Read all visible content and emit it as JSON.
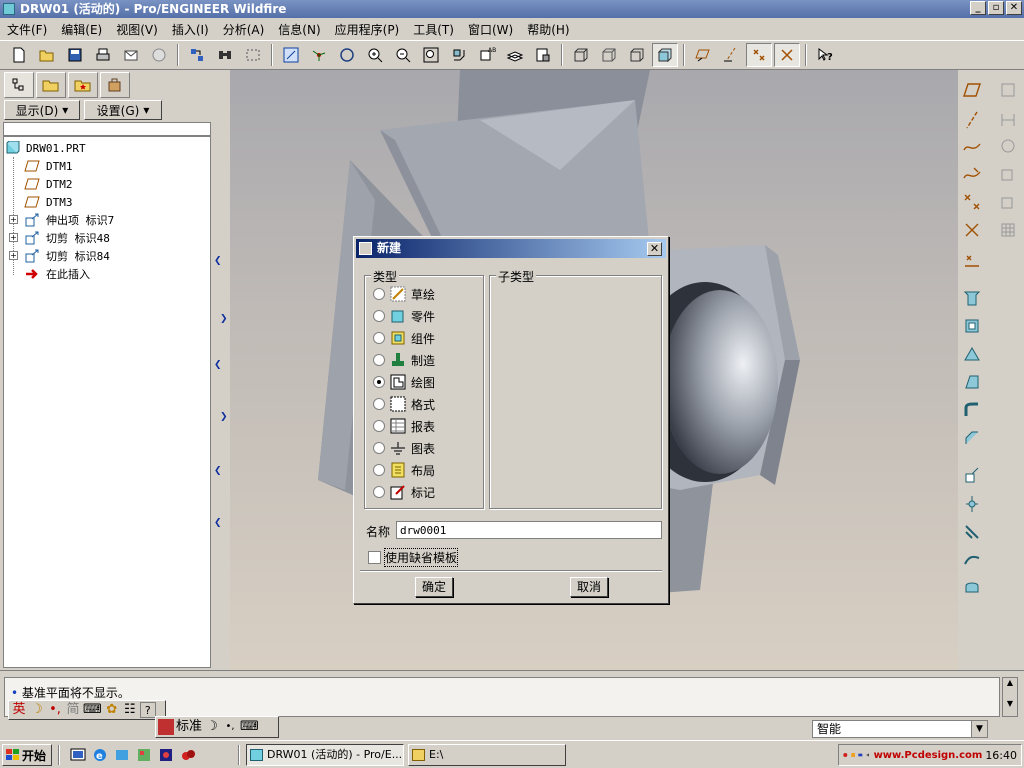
{
  "window": {
    "title": "DRW01 (活动的) - Pro/ENGINEER Wildfire",
    "min": "_",
    "restore": "▫",
    "close": "✕"
  },
  "menu": [
    "文件(F)",
    "编辑(E)",
    "视图(V)",
    "插入(I)",
    "分析(A)",
    "信息(N)",
    "应用程序(P)",
    "工具(T)",
    "窗口(W)",
    "帮助(H)"
  ],
  "toolbar_icons": [
    "new-icon",
    "open-icon",
    "save-icon",
    "print-icon",
    "email-icon",
    "send-icon",
    "regenerate-icon",
    "find-icon",
    "select-box-icon",
    "repaint-icon",
    "spin-center-icon",
    "orient-icon",
    "zoom-in-icon",
    "zoom-out-icon",
    "refit-icon",
    "reorient-icon",
    "saved-view-icon",
    "layers-icon",
    "view-manager-icon",
    "wireframe-icon",
    "hidden-line-icon",
    "no-hidden-icon",
    "shading-icon",
    "datum-plane-display-icon",
    "datum-axis-display-icon",
    "datum-point-display-icon",
    "csys-display-icon",
    "context-help-icon"
  ],
  "left_panel": {
    "show_button": "显示(D)",
    "settings_button": "设置(G)",
    "tree": [
      {
        "label": "DRW01.PRT",
        "icon": "part-icon",
        "indent": 0,
        "expand": ""
      },
      {
        "label": "DTM1",
        "icon": "datum-plane-icon",
        "indent": 1,
        "expand": ""
      },
      {
        "label": "DTM2",
        "icon": "datum-plane-icon",
        "indent": 1,
        "expand": ""
      },
      {
        "label": "DTM3",
        "icon": "datum-plane-icon",
        "indent": 1,
        "expand": ""
      },
      {
        "label": "伸出项 标识7",
        "icon": "extrude-icon",
        "indent": 1,
        "expand": "+"
      },
      {
        "label": "切剪 标识48",
        "icon": "cut-icon",
        "indent": 1,
        "expand": "+"
      },
      {
        "label": "切剪 标识84",
        "icon": "cut-icon",
        "indent": 1,
        "expand": "+"
      },
      {
        "label": "在此插入",
        "icon": "insert-here-arrow-icon",
        "indent": 1,
        "expand": ""
      }
    ]
  },
  "dialog": {
    "title": "新建",
    "type_group_label": "类型",
    "subtype_group_label": "子类型",
    "options": [
      {
        "label": "草绘",
        "icon": "sketch-icon",
        "selected": false
      },
      {
        "label": "零件",
        "icon": "part-icon",
        "selected": false
      },
      {
        "label": "组件",
        "icon": "assembly-icon",
        "selected": false
      },
      {
        "label": "制造",
        "icon": "manufacturing-icon",
        "selected": false
      },
      {
        "label": "绘图",
        "icon": "drawing-icon",
        "selected": true
      },
      {
        "label": "格式",
        "icon": "format-icon",
        "selected": false
      },
      {
        "label": "报表",
        "icon": "report-icon",
        "selected": false
      },
      {
        "label": "图表",
        "icon": "diagram-icon",
        "selected": false
      },
      {
        "label": "布局",
        "icon": "layout-icon",
        "selected": false
      },
      {
        "label": "标记",
        "icon": "markup-icon",
        "selected": false
      }
    ],
    "name_label": "名称",
    "name_value": "drw0001",
    "use_default_template": "使用缺省模板",
    "ok": "确定",
    "cancel": "取消"
  },
  "message": "基准平面将不显示。",
  "ime_bar1": [
    "英",
    "☽",
    "•,",
    "简",
    "⌨",
    "✿",
    "☷",
    "?"
  ],
  "ime_bar2": [
    "标准",
    "☽",
    "•,",
    "⌨"
  ],
  "smart_select": "智能",
  "taskbar": {
    "start": "开始",
    "tasks": [
      {
        "label": "DRW01 (活动的) - Pro/E...",
        "active": true
      },
      {
        "label": "E:\\",
        "active": false
      }
    ],
    "clock": "16:40",
    "watermark": "www.Pcdesign.com"
  }
}
